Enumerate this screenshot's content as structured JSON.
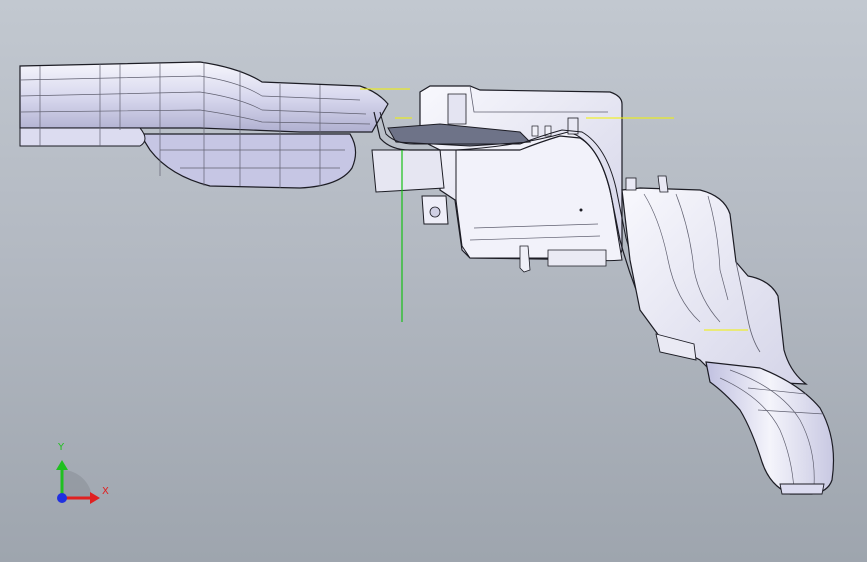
{
  "viewport": {
    "background_top": "#c2c8d0",
    "background_bottom": "#9ea5ae"
  },
  "model": {
    "body_fill": "#eeeef8",
    "body_fill_dark": "#b8b8d8",
    "section_fill": "#6e7388",
    "edge_color": "#1c1c24",
    "inner_line_color": "#606070"
  },
  "sketch": {
    "yellow": "#f2f200",
    "green": "#18c018"
  },
  "triad": {
    "x_label": "X",
    "y_label": "Y",
    "x_color": "#e02020",
    "y_color": "#20c020",
    "z_color": "#2030e0",
    "icons": [
      "axis-x-icon",
      "axis-y-icon",
      "axis-z-icon"
    ]
  }
}
